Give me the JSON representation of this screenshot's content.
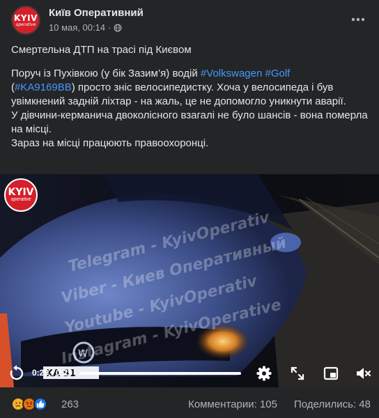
{
  "post": {
    "page_name": "Київ Оперативний",
    "avatar_text_main": "KYIV",
    "avatar_text_sub": "operative",
    "date": "10 мая, 00:14",
    "dot": "·",
    "audience_icon": "globe-icon",
    "more_icon": "more-horizontal-icon"
  },
  "text": {
    "title": "Смертельна ДТП на трасі під Києвом",
    "p1_a": "Поруч із Пухівкою (у бік Зазим’я) водій ",
    "tag1": "#Volkswagen",
    "space": " ",
    "tag2": "#Golf",
    "p1_b": "(",
    "tag3": "#KA9169BB",
    "p1_c": ") просто зніс велосипедистку. Хоча у велосипеда і був увімкнений задній ліхтар - на жаль, це не допомогло уникнути аварії.",
    "p2": "У дівчини-керманича двоколісного взагалі не було шансів - вона померла на місці.",
    "p3": "Зараз на місці працюють правоохоронці."
  },
  "video": {
    "logo_main": "KYIV",
    "logo_sub": "operative",
    "watermark": [
      "Telegram - KyivOperativ",
      "Viber - Киев Оперативный",
      "Youtube - KyivOperativ",
      "Instagram - KyivOperative"
    ],
    "plate_text": "KA 91",
    "time": "0:29 / 0:29",
    "progress": 1.0,
    "icons": [
      "replay-icon",
      "settings-icon",
      "fullscreen-icon",
      "picture-in-picture-icon",
      "volume-muted-icon"
    ]
  },
  "footer": {
    "reaction_icons": [
      "sad-reaction-icon",
      "angry-reaction-icon",
      "like-reaction-icon"
    ],
    "reaction_count": "263",
    "comments": "Комментарии: 105",
    "shares": "Поделились: 48"
  },
  "colors": {
    "background": "#242526",
    "text": "#e4e6eb",
    "secondary": "#b0b3b8",
    "link": "#4599ff",
    "brand_red": "#d4202a"
  }
}
